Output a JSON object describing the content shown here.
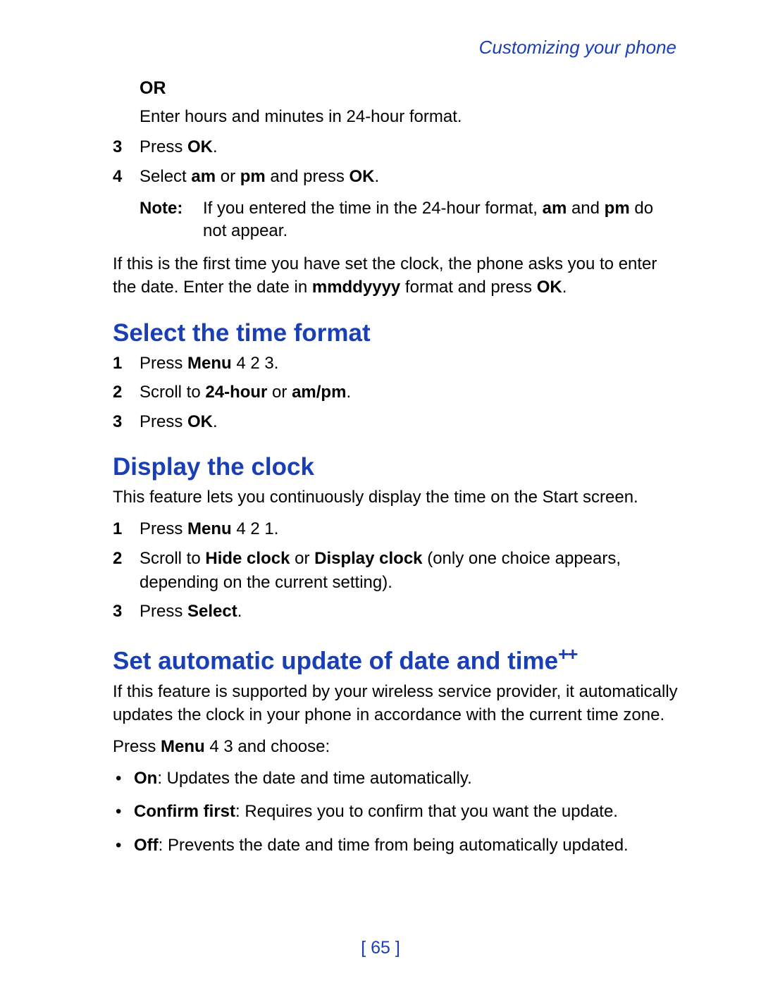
{
  "header": {
    "section_link": "Customizing your phone"
  },
  "intro": {
    "or_label": "OR",
    "or_text": "Enter hours and minutes in 24-hour format.",
    "steps": [
      {
        "pre": "Press ",
        "b1": "OK",
        "post": "."
      },
      {
        "pre": "Select ",
        "b1": "am",
        "mid1": " or ",
        "b2": "pm",
        "mid2": " and press ",
        "b3": "OK",
        "post": "."
      }
    ],
    "note": {
      "label": "Note:",
      "pre": "If you entered the time in the 24-hour format, ",
      "b1": "am",
      "mid": " and ",
      "b2": "pm",
      "post": " do not appear."
    },
    "first_time": {
      "pre": "If this is the first time you have set the clock, the phone asks you to enter the date. Enter the date in ",
      "b1": "mmddyyyy",
      "mid": " format and press ",
      "b2": "OK",
      "post": "."
    }
  },
  "time_format": {
    "title": "Select the time format",
    "steps": [
      {
        "pre": "Press ",
        "b1": "Menu",
        "post": " 4 2 3."
      },
      {
        "pre": "Scroll to ",
        "b1": "24-hour",
        "mid1": " or ",
        "b2": "am/pm",
        "post": "."
      },
      {
        "pre": "Press ",
        "b1": "OK",
        "post": "."
      }
    ]
  },
  "display_clock": {
    "title": "Display the clock",
    "desc": "This feature lets you continuously display the time on the Start screen.",
    "steps": [
      {
        "pre": "Press ",
        "b1": "Menu",
        "post": " 4 2 1."
      },
      {
        "pre": "Scroll to ",
        "b1": "Hide clock",
        "mid1": " or ",
        "b2": "Display clock",
        "post": " (only one choice appears, depending on the current setting)."
      },
      {
        "pre": "Press ",
        "b1": "Select",
        "post": "."
      }
    ]
  },
  "auto_update": {
    "title": "Set automatic update of date and time",
    "title_sup": "++",
    "desc": "If this feature is supported by your wireless service provider, it  automatically updates the clock in your phone in accordance with the current time zone.",
    "press_line": {
      "pre": "Press ",
      "b1": "Menu",
      "post": " 4 3 and choose:"
    },
    "options": [
      {
        "b": "On",
        "post": ": Updates the date and time automatically."
      },
      {
        "b": "Confirm first",
        "post": ": Requires you to confirm that you want the update."
      },
      {
        "b": "Off",
        "post": ": Prevents the date and time from being automatically updated."
      }
    ]
  },
  "page_number": "[ 65 ]"
}
